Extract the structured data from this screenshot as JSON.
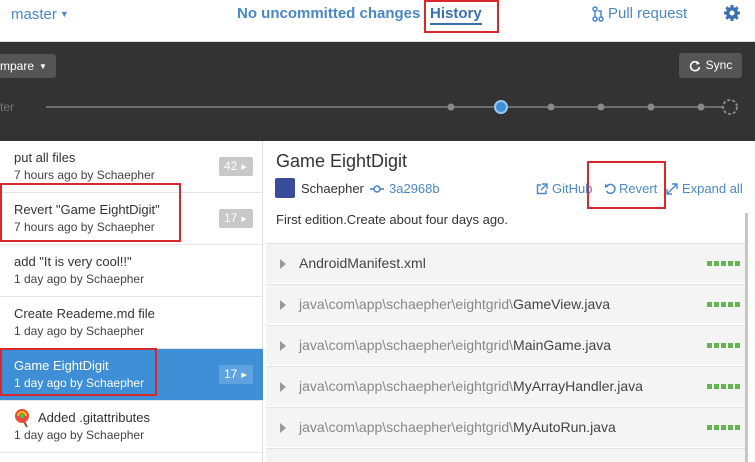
{
  "topbar": {
    "branch": "master",
    "uncommitted": "No uncommitted changes",
    "history": "History",
    "pull_request": "Pull request",
    "settings_icon": "gear-icon"
  },
  "toolbar": {
    "compare_label": "mpare",
    "sync_label": "Sync",
    "timeline_label": "ter",
    "timeline_selected_index": 1,
    "timeline_node_count": 6
  },
  "commits": [
    {
      "title": "put all files",
      "meta": "7 hours ago by Schaepher",
      "count": "42",
      "selected": false
    },
    {
      "title": "Revert \"Game EightDigit\"",
      "meta": "7 hours ago by Schaepher",
      "count": "17",
      "selected": false
    },
    {
      "title": "add \"It is very cool!!\"",
      "meta": "1 day ago by Schaepher",
      "count": "",
      "selected": false
    },
    {
      "title": "Create Reademe.md file",
      "meta": "1 day ago by Schaepher",
      "count": "",
      "selected": false
    },
    {
      "title": "Game EightDigit",
      "meta": "1 day ago by Schaepher",
      "count": "17",
      "selected": true
    },
    {
      "title": "Added .gitattributes",
      "meta": "1 day ago by Schaepher",
      "count": "",
      "selected": false
    }
  ],
  "detail": {
    "title": "Game EightDigit",
    "author": "Schaepher",
    "sha": "3a2968b",
    "github_label": "GitHub",
    "revert_label": "Revert",
    "expand_label": "Expand all",
    "description": "First edition.Create about four days ago."
  },
  "files": [
    {
      "dir": "",
      "name": "AndroidManifest.xml"
    },
    {
      "dir": "java\\com\\app\\schaepher\\eightgrid\\",
      "name": "GameView.java"
    },
    {
      "dir": "java\\com\\app\\schaepher\\eightgrid\\",
      "name": "MainGame.java"
    },
    {
      "dir": "java\\com\\app\\schaepher\\eightgrid\\",
      "name": "MyArrayHandler.java"
    },
    {
      "dir": "java\\com\\app\\schaepher\\eightgrid\\",
      "name": "MyAutoRun.java"
    }
  ],
  "colors": {
    "accent": "#4a87c8",
    "selected_row": "#3e8fd6",
    "dark_band": "#333333",
    "annotation_red": "#d9272e",
    "diff_added": "#62b550"
  }
}
